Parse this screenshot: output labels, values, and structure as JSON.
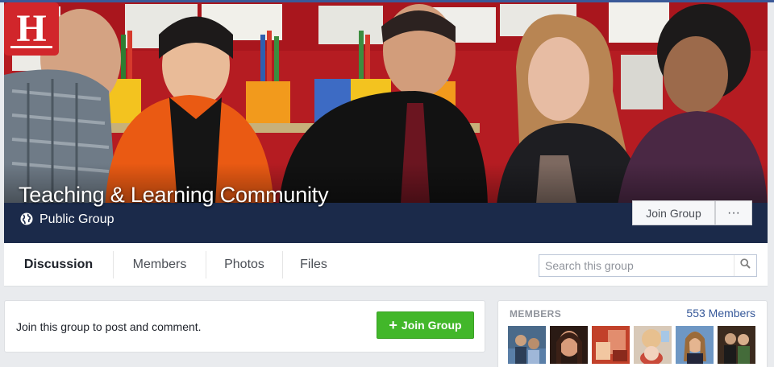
{
  "group": {
    "name": "Teaching & Learning Community",
    "privacy": "Public Group",
    "join_label": "Join Group",
    "more_label": "···",
    "logo_letter": "H"
  },
  "tabs": [
    {
      "label": "Discussion",
      "active": true
    },
    {
      "label": "Members",
      "active": false
    },
    {
      "label": "Photos",
      "active": false
    },
    {
      "label": "Files",
      "active": false
    }
  ],
  "search": {
    "placeholder": "Search this group",
    "value": ""
  },
  "join_card": {
    "message": "Join this group to post and comment.",
    "button_label": "Join Group",
    "button_icon": "plus-icon"
  },
  "members_panel": {
    "heading": "MEMBERS",
    "count_text": "553 Members"
  },
  "colors": {
    "brand_blue": "#3b5998",
    "join_green": "#42b72a",
    "link_blue": "#365899",
    "cover_band": "#1b2a4a",
    "logo_red": "#d1262b"
  }
}
